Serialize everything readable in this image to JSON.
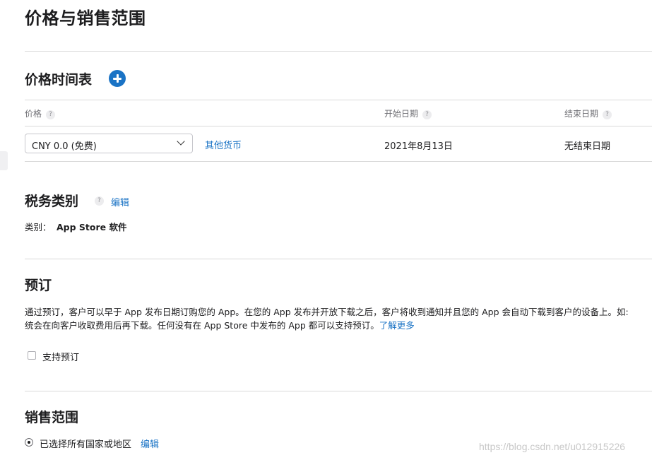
{
  "page": {
    "title": "价格与销售范围"
  },
  "price_schedule": {
    "title": "价格时间表",
    "add_icon": "plus-circle-icon",
    "columns": {
      "price": "价格",
      "start_date": "开始日期",
      "end_date": "结束日期"
    },
    "help_icon_glyph": "?",
    "row": {
      "price_value": "CNY 0.0 (免费)",
      "other_currency": "其他货币",
      "start_date": "2021年8月13日",
      "end_date": "无结束日期"
    }
  },
  "tax": {
    "title": "税务类别",
    "help_icon_glyph": "?",
    "edit": "编辑",
    "category_label": "类别：",
    "category_value": "App Store 软件"
  },
  "preorder": {
    "title": "预订",
    "line1": "通过预订，客户可以早于 App 发布日期订购您的 App。在您的 App 发布并开放下载之后，客户将收到通知并且您的 App 会自动下载到客户的设备上。如:",
    "line2": "统会在向客户收取费用后再下载。任何没有在 App Store 中发布的 App 都可以支持预订。",
    "learn_more": "了解更多",
    "checkbox_label": "支持预订",
    "checkbox_checked": false
  },
  "availability": {
    "title": "销售范围",
    "selected_label": "已选择所有国家或地区",
    "edit": "编辑",
    "selected": true
  },
  "watermark": "https://blog.csdn.net/u012915226",
  "colors": {
    "accent": "#1a73c5",
    "divider": "#d9d9d9",
    "muted": "#6e6e73"
  }
}
